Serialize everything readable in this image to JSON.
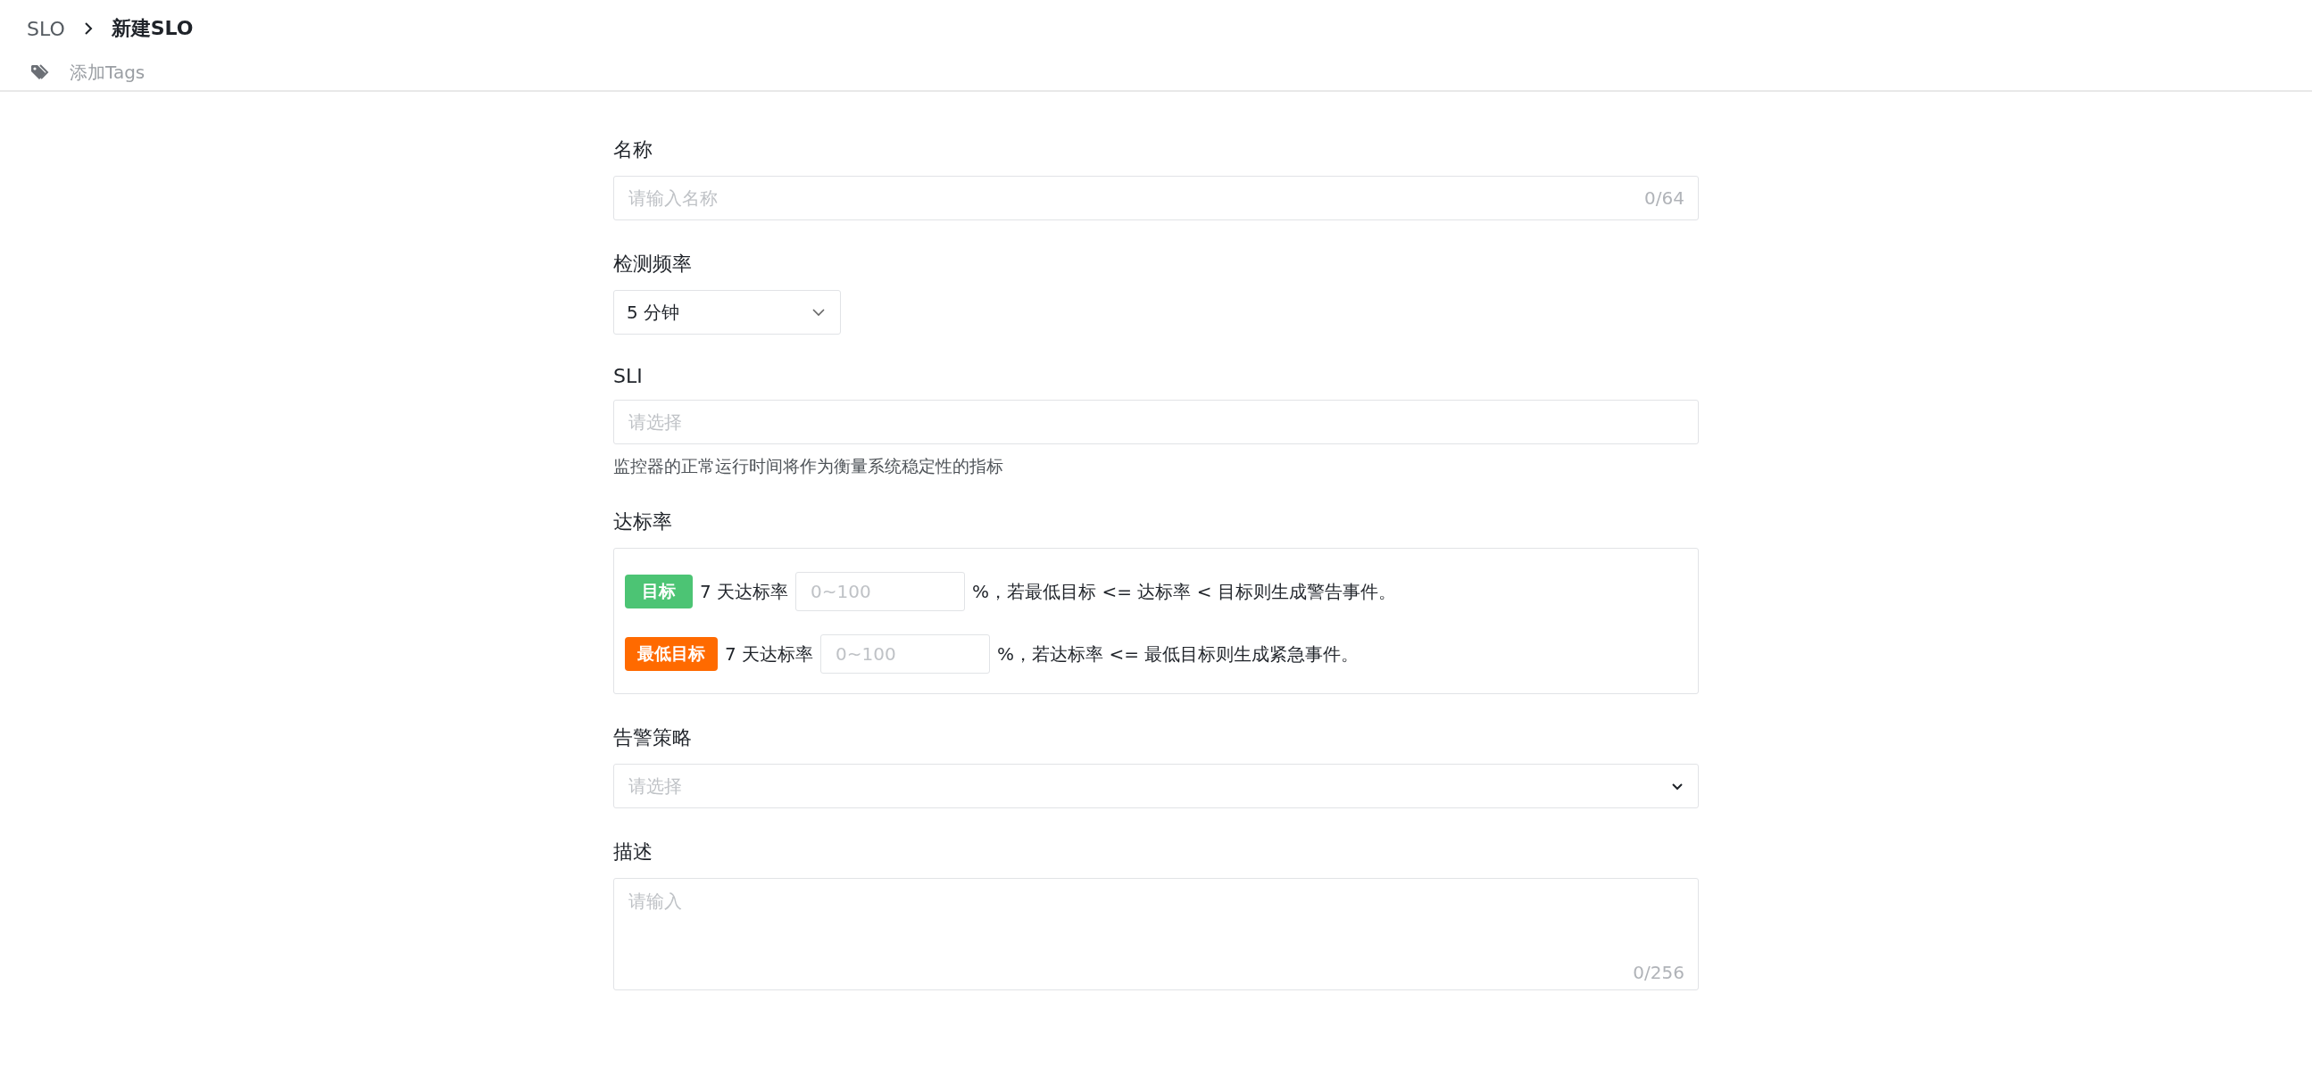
{
  "breadcrumb": {
    "parent": "SLO",
    "current": "新建SLO"
  },
  "tags": {
    "label": "添加Tags"
  },
  "fields": [
    {
      "kind": "text",
      "label": "名称",
      "placeholder": "请输入名称",
      "counter": "0/64"
    },
    {
      "kind": "dropdown",
      "label": "检测频率",
      "value": "5 分钟"
    },
    {
      "kind": "picker",
      "label": "SLI",
      "placeholder": "请选择",
      "help": "监控器的正常运行时间将作为衡量系统稳定性的指标"
    },
    {
      "kind": "targets",
      "label": "达标率",
      "rows": [
        {
          "tag": "目标",
          "color": "#4cc474",
          "period": "7 天达标率",
          "placeholder": "0~100",
          "suffix": "%，若最低目标 <= 达标率 < 目标则生成警告事件。"
        },
        {
          "tag": "最低目标",
          "color": "#ff6a00",
          "period": "7 天达标率",
          "placeholder": "0~100",
          "suffix": "%，若达标率 <= 最低目标则生成紧急事件。"
        }
      ]
    },
    {
      "kind": "select",
      "label": "告警策略",
      "placeholder": "请选择"
    },
    {
      "kind": "textarea",
      "label": "描述",
      "placeholder": "请输入",
      "counter": "0/256"
    }
  ]
}
